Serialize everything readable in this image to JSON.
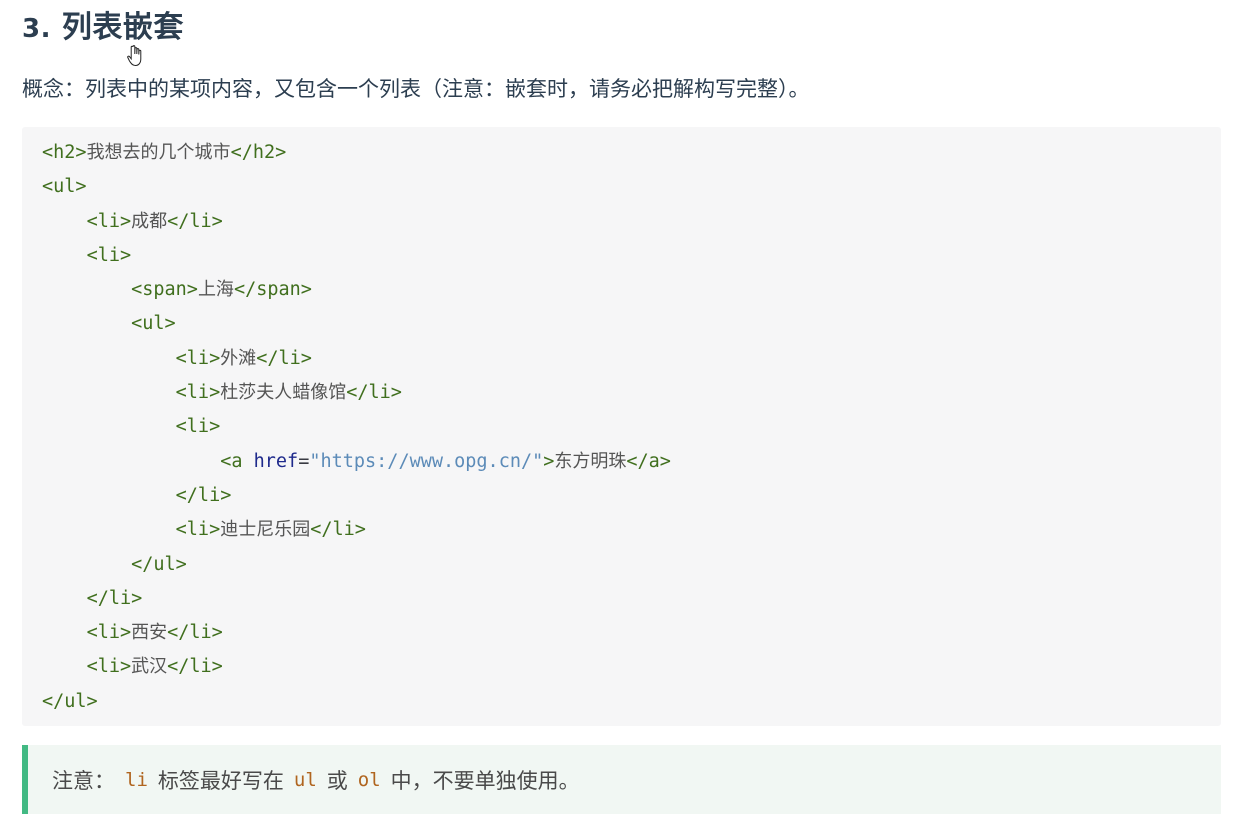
{
  "heading": {
    "number": "3.",
    "title": "列表嵌套"
  },
  "concept": "概念：列表中的某项内容，又包含一个列表（注意：嵌套时，请务必把解构写完整）。",
  "code_lines": [
    {
      "indent": 0,
      "parts": [
        [
          "tag",
          "<h2>"
        ],
        [
          "txt",
          "我想去的几个城市"
        ],
        [
          "tag",
          "</h2>"
        ]
      ]
    },
    {
      "indent": 0,
      "parts": [
        [
          "tag",
          "<ul>"
        ]
      ]
    },
    {
      "indent": 1,
      "parts": [
        [
          "tag",
          "<li>"
        ],
        [
          "txt",
          "成都"
        ],
        [
          "tag",
          "</li>"
        ]
      ]
    },
    {
      "indent": 1,
      "parts": [
        [
          "tag",
          "<li>"
        ]
      ]
    },
    {
      "indent": 2,
      "parts": [
        [
          "tag",
          "<span>"
        ],
        [
          "txt",
          "上海"
        ],
        [
          "tag",
          "</span>"
        ]
      ]
    },
    {
      "indent": 2,
      "parts": [
        [
          "tag",
          "<ul>"
        ]
      ]
    },
    {
      "indent": 3,
      "parts": [
        [
          "tag",
          "<li>"
        ],
        [
          "txt",
          "外滩"
        ],
        [
          "tag",
          "</li>"
        ]
      ]
    },
    {
      "indent": 3,
      "parts": [
        [
          "tag",
          "<li>"
        ],
        [
          "txt",
          "杜莎夫人蜡像馆"
        ],
        [
          "tag",
          "</li>"
        ]
      ]
    },
    {
      "indent": 3,
      "parts": [
        [
          "tag",
          "<li>"
        ]
      ]
    },
    {
      "indent": 4,
      "parts": [
        [
          "tag",
          "<a "
        ],
        [
          "attr",
          "href"
        ],
        [
          "plain",
          "="
        ],
        [
          "str",
          "\"https://www.opg.cn/\""
        ],
        [
          "tag",
          ">"
        ],
        [
          "txt",
          "东方明珠"
        ],
        [
          "tag",
          "</a>"
        ]
      ]
    },
    {
      "indent": 3,
      "parts": [
        [
          "tag",
          "</li>"
        ]
      ]
    },
    {
      "indent": 3,
      "parts": [
        [
          "tag",
          "<li>"
        ],
        [
          "txt",
          "迪士尼乐园"
        ],
        [
          "tag",
          "</li>"
        ]
      ]
    },
    {
      "indent": 2,
      "parts": [
        [
          "tag",
          "</ul>"
        ]
      ]
    },
    {
      "indent": 1,
      "parts": [
        [
          "tag",
          "</li>"
        ]
      ]
    },
    {
      "indent": 1,
      "parts": [
        [
          "tag",
          "<li>"
        ],
        [
          "txt",
          "西安"
        ],
        [
          "tag",
          "</li>"
        ]
      ]
    },
    {
      "indent": 1,
      "parts": [
        [
          "tag",
          "<li>"
        ],
        [
          "txt",
          "武汉"
        ],
        [
          "tag",
          "</li>"
        ]
      ]
    },
    {
      "indent": 0,
      "parts": [
        [
          "tag",
          "</ul>"
        ]
      ]
    }
  ],
  "tip": {
    "prefix": "注意：",
    "code1": "li",
    "text1": "标签最好写在",
    "code2": "ul",
    "text2": "或",
    "code3": "ol",
    "text3": "中，不要单独使用。"
  },
  "icons": {
    "cursor": "hand-pointer-icon"
  }
}
